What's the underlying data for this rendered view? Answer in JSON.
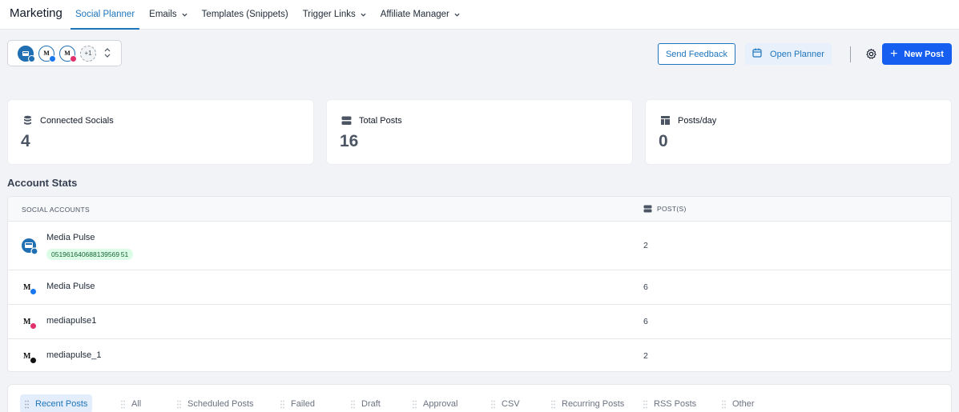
{
  "nav": {
    "brand": "Marketing",
    "items": [
      {
        "label": "Social Planner",
        "active": true,
        "dropdown": false
      },
      {
        "label": "Emails",
        "active": false,
        "dropdown": true
      },
      {
        "label": "Templates (Snippets)",
        "active": false,
        "dropdown": false
      },
      {
        "label": "Trigger Links",
        "active": false,
        "dropdown": true
      },
      {
        "label": "Affiliate Manager",
        "active": false,
        "dropdown": true
      }
    ]
  },
  "toolbar": {
    "more_accounts": "+1",
    "feedback_label": "Send Feedback",
    "planner_label": "Open Planner",
    "new_post_label": "New Post"
  },
  "stats": [
    {
      "label": "Connected Socials",
      "value": "4",
      "icon": "database-icon"
    },
    {
      "label": "Total Posts",
      "value": "16",
      "icon": "server-icon"
    },
    {
      "label": "Posts/day",
      "value": "0",
      "icon": "layout-icon"
    }
  ],
  "account_stats": {
    "title": "Account Stats",
    "col_accounts": "SOCIAL ACCOUNTS",
    "col_posts": "POST(S)",
    "rows": [
      {
        "name": "Media Pulse",
        "id": "051961640688139569 51",
        "posts": "2",
        "network": "google-business",
        "badge_color": "#1f6fb2"
      },
      {
        "name": "Media Pulse",
        "posts": "6",
        "network": "facebook",
        "badge_color": "#1877f2"
      },
      {
        "name": "mediapulse1",
        "posts": "6",
        "network": "instagram",
        "badge_color": "#e1306c"
      },
      {
        "name": "mediapulse_1",
        "posts": "2",
        "network": "threads",
        "badge_color": "#111111"
      }
    ]
  },
  "tabs": [
    "Recent Posts",
    "All",
    "Scheduled Posts",
    "Failed",
    "Draft",
    "Approval",
    "CSV",
    "Recurring Posts",
    "RSS Posts",
    "Other"
  ],
  "colors": {
    "accent": "#1d75bd",
    "primary_button": "#155eef",
    "id_badge_bg": "#dcfce7"
  }
}
